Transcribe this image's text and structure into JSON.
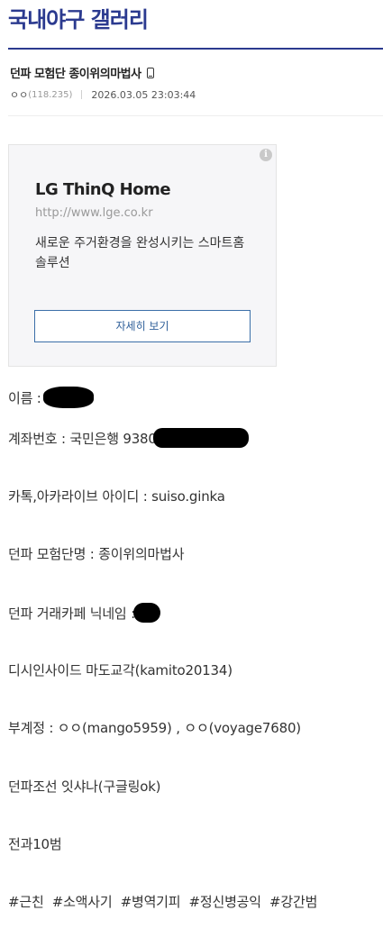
{
  "header": {
    "gallery_title": "국내야구 갤러리"
  },
  "post": {
    "title": "던파 모험단 종이위의마법사",
    "author": "ㅇㅇ",
    "ip": "(118.235)",
    "datetime": "2026.03.05 23:03:44",
    "device_icon": "mobile-phone-icon"
  },
  "ad": {
    "title": "LG ThinQ Home",
    "url": "http://www.lge.co.kr",
    "description": "새로운 주거환경을 완성시키는 스마트홈 솔루션",
    "button_label": "자세히 보기",
    "info_icon": "info-icon"
  },
  "body": {
    "name_label": "이름 : ",
    "account_label": "계좌번호 : 국민은행 9380",
    "kakao_line": "카톡,아카라이브 아이디 : suiso.ginka",
    "adventure_line": "던파 모험단명 : 종이위의마법사",
    "cafe_label": "던파 거래카페 닉네임 : ",
    "dcinside_line": "디시인사이드 마도교각(kamito20134)",
    "sub_accounts_line": "부계정 : ㅇㅇ(mango5959) , ㅇㅇ(voyage7680)",
    "joseon_line": "던파조선 잇샤나(구글링ok)",
    "record_line": "전과10범",
    "tags_line": "#근친  #소액사기  #병역기피  #정신병공익  #강간범"
  }
}
